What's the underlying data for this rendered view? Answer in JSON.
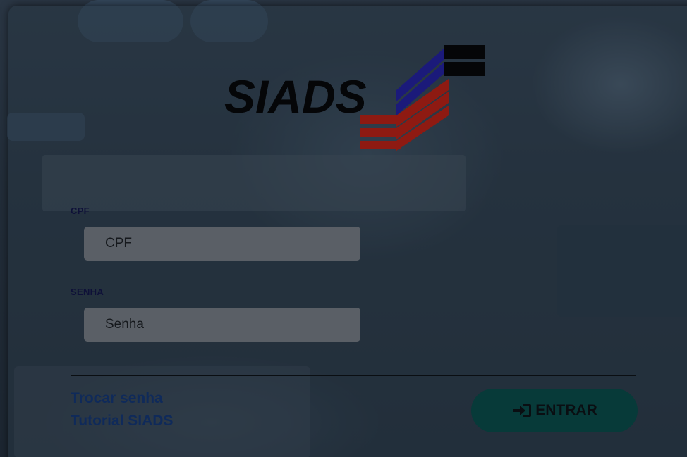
{
  "login": {
    "logo_text": "SIADS",
    "cpf_label": "CPF",
    "cpf_placeholder": "CPF",
    "senha_label": "SENHA",
    "senha_placeholder": "Senha",
    "links": {
      "change_password": "Trocar senha",
      "tutorial": "Tutorial SIADS"
    },
    "enter_button": "ENTRAR",
    "enter_icon": "sign-in-icon"
  },
  "colors": {
    "label": "#0e1038",
    "link": "#0f2a5a",
    "button_bg": "#073a39",
    "input_bg": "#5a5f66",
    "logo_blue": "#1b1a7a",
    "logo_red": "#8e1a12"
  }
}
